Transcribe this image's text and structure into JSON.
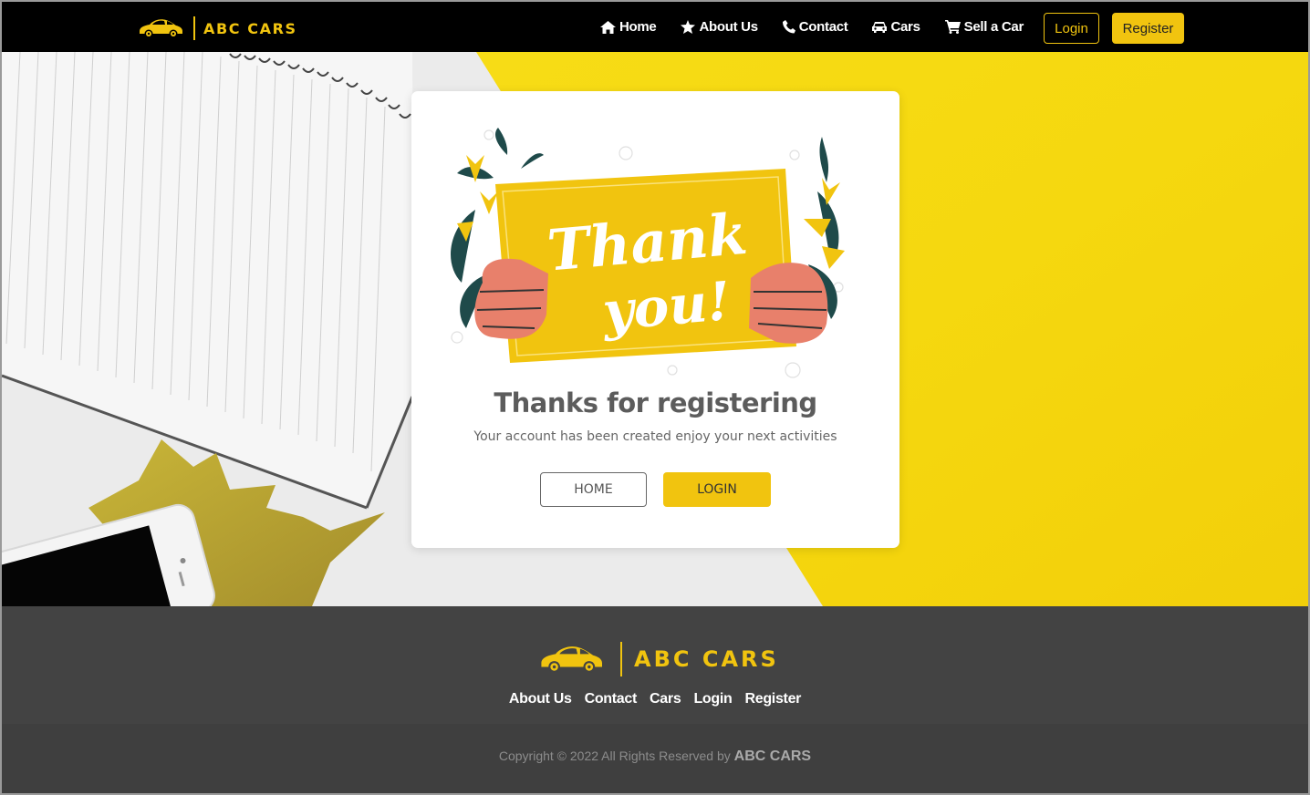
{
  "brand": {
    "name": "ABC CARS",
    "accent": "#f1c40f"
  },
  "nav": {
    "items": [
      {
        "label": "Home",
        "icon": "home-icon"
      },
      {
        "label": "About Us",
        "icon": "star-icon"
      },
      {
        "label": "Contact",
        "icon": "phone-icon"
      },
      {
        "label": "Cars",
        "icon": "car-icon"
      },
      {
        "label": "Sell a Car",
        "icon": "cart-icon"
      }
    ],
    "login_label": "Login",
    "register_label": "Register"
  },
  "card": {
    "illustration_text_1": "Thank",
    "illustration_text_2": "you!",
    "title": "Thanks for registering",
    "subtitle": "Your account has been created enjoy your next activities",
    "home_button": "HOME",
    "login_button": "LOGIN"
  },
  "footer": {
    "brand": "ABC CARS",
    "links": [
      "About Us",
      "Contact",
      "Cars",
      "Login",
      "Register"
    ],
    "copyright_prefix": "Copyright © 2022 All Rights Reserved by",
    "copyright_brand": "ABC CARS"
  }
}
